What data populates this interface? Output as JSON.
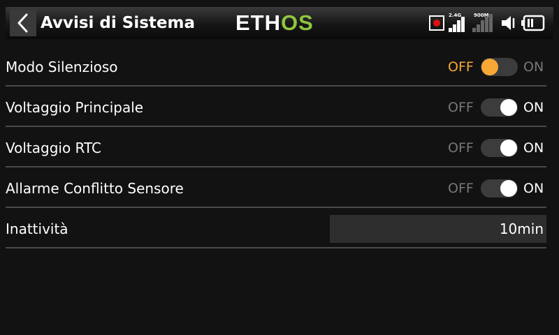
{
  "header": {
    "title": "Avvisi di Sistema",
    "logo_main": "ETH",
    "logo_accent": "OS",
    "signal_1_label": "2.4G",
    "signal_2_label": "900M"
  },
  "colors": {
    "accent_orange": "#f7a836",
    "logo_green": "#8dc63f",
    "record_red": "#e01010",
    "label_dim": "#777777"
  },
  "settings": [
    {
      "label": "Modo Silenzioso",
      "off_label": "OFF",
      "on_label": "ON",
      "state": "off"
    },
    {
      "label": "Voltaggio Principale",
      "off_label": "OFF",
      "on_label": "ON",
      "state": "on"
    },
    {
      "label": "Voltaggio RTC",
      "off_label": "OFF",
      "on_label": "ON",
      "state": "on"
    },
    {
      "label": "Allarme Conflitto Sensore",
      "off_label": "OFF",
      "on_label": "ON",
      "state": "on"
    }
  ],
  "inactivity": {
    "label": "Inattività",
    "value": "10min"
  }
}
